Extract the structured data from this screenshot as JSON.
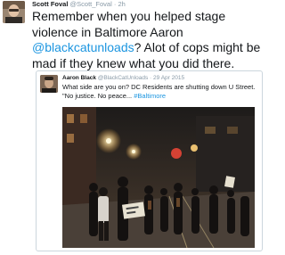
{
  "tweet": {
    "author_name": "Scott Foval",
    "author_handle": "@Scott_Foval",
    "separator": "·",
    "time": "2h",
    "text_part1": "Remember when you helped stage violence in Baltimore Aaron ",
    "mention": "@blackcatunloads",
    "text_part2": "? Alot of cops might be mad if they knew what you did there."
  },
  "quoted_tweet": {
    "author_name": "Aaron Black",
    "author_handle": "@BlackCatUnloads",
    "separator": "·",
    "date": "29 Apr 2015",
    "text": "What side are you on? DC Residents are shutting down U Street. \"No justice. No peace... ",
    "hashtag": "#Baltimore"
  },
  "colors": {
    "link": "#1b95e0",
    "meta_gray": "#8899a6",
    "card_border": "#ccd6dd"
  }
}
